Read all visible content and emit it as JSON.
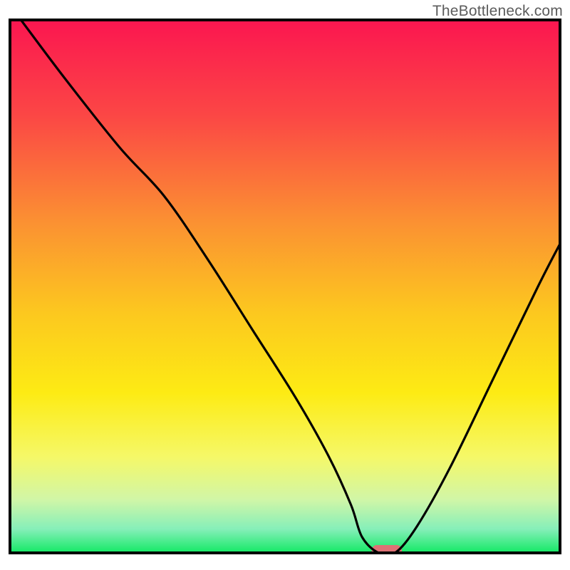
{
  "watermark": "TheBottleneck.com",
  "chart_data": {
    "type": "line",
    "title": "",
    "xlabel": "",
    "ylabel": "",
    "xlim": [
      0,
      100
    ],
    "ylim": [
      0,
      100
    ],
    "series": [
      {
        "name": "curve",
        "x": [
          2,
          10,
          20,
          28,
          36,
          44,
          52,
          58,
          62,
          64,
          67,
          70,
          74,
          80,
          88,
          96,
          100
        ],
        "values": [
          100,
          89,
          76,
          67,
          55,
          42,
          29,
          18,
          9,
          3,
          0,
          0,
          5,
          16,
          33,
          50,
          58
        ]
      }
    ],
    "marker": {
      "name": "optimal-zone",
      "x_center": 68.5,
      "width": 5.5,
      "color": "#de7175"
    },
    "gradient_stops": [
      {
        "offset": 0.0,
        "color": "#fb1650"
      },
      {
        "offset": 0.18,
        "color": "#fb4745"
      },
      {
        "offset": 0.38,
        "color": "#fb9132"
      },
      {
        "offset": 0.55,
        "color": "#fcc81f"
      },
      {
        "offset": 0.7,
        "color": "#fdeb14"
      },
      {
        "offset": 0.82,
        "color": "#f5f868"
      },
      {
        "offset": 0.9,
        "color": "#d1f6a7"
      },
      {
        "offset": 0.955,
        "color": "#86efb9"
      },
      {
        "offset": 1.0,
        "color": "#13e965"
      }
    ],
    "frame": {
      "stroke": "#000000",
      "width": 4
    }
  }
}
